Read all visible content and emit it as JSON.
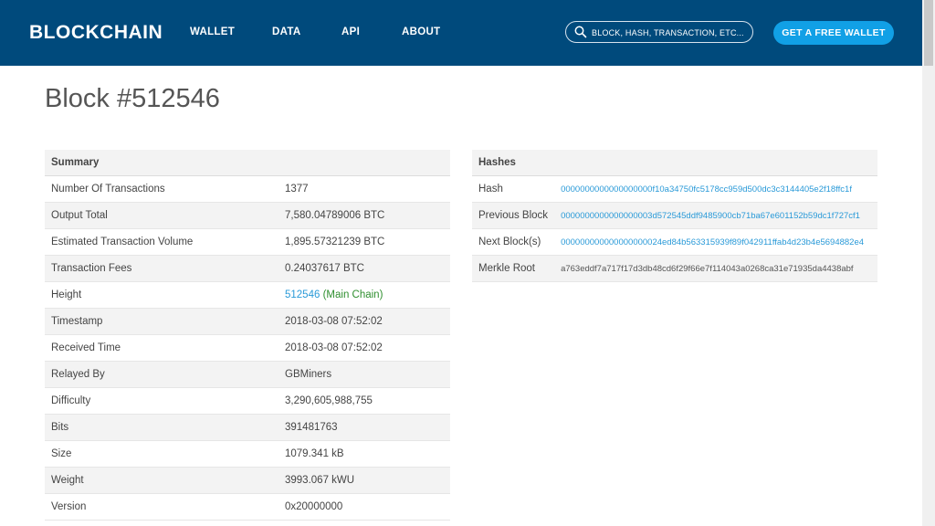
{
  "nav": {
    "brand": "BLOCKCHAIN",
    "links": [
      "WALLET",
      "DATA",
      "API",
      "ABOUT"
    ],
    "search_placeholder": "BLOCK, HASH, TRANSACTION, ETC...",
    "cta": "GET A FREE WALLET"
  },
  "page": {
    "title": "Block #512546"
  },
  "summary": {
    "header": "Summary",
    "rows": [
      {
        "label": "Number Of Transactions",
        "value": "1377"
      },
      {
        "label": "Output Total",
        "value": "7,580.04789006 BTC"
      },
      {
        "label": "Estimated Transaction Volume",
        "value": "1,895.57321239 BTC"
      },
      {
        "label": "Transaction Fees",
        "value": "0.24037617 BTC"
      },
      {
        "label": "Height",
        "value": "512546",
        "extra": "(Main Chain)"
      },
      {
        "label": "Timestamp",
        "value": "2018-03-08 07:52:02"
      },
      {
        "label": "Received Time",
        "value": "2018-03-08 07:52:02"
      },
      {
        "label": "Relayed By",
        "value": "GBMiners"
      },
      {
        "label": "Difficulty",
        "value": "3,290,605,988,755"
      },
      {
        "label": "Bits",
        "value": "391481763"
      },
      {
        "label": "Size",
        "value": "1079.341 kB"
      },
      {
        "label": "Weight",
        "value": "3993.067 kWU"
      },
      {
        "label": "Version",
        "value": "0x20000000"
      }
    ]
  },
  "hashes": {
    "header": "Hashes",
    "rows": [
      {
        "label": "Hash",
        "value": "0000000000000000000f10a34750fc5178cc959d500dc3c3144405e2f18ffc1f"
      },
      {
        "label": "Previous Block",
        "value": "0000000000000000003d572545ddf9485900cb71ba67e601152b59dc1f727cf1"
      },
      {
        "label": "Next Block(s)",
        "value": "000000000000000000024ed84b563315939f89f042911ffab4d23b4e5694882e4"
      },
      {
        "label": "Merkle Root",
        "value": "a763eddf7a717f17d3db48cd6f29f66e7f114043a0268ca31e71935da4438abf"
      }
    ]
  },
  "colors": {
    "nav_bg": "#004a7c",
    "cta_bg": "#11a0e6",
    "link": "#2a9ad8",
    "main_chain": "#2f8f2f"
  },
  "icons": {
    "search": "search-icon"
  }
}
